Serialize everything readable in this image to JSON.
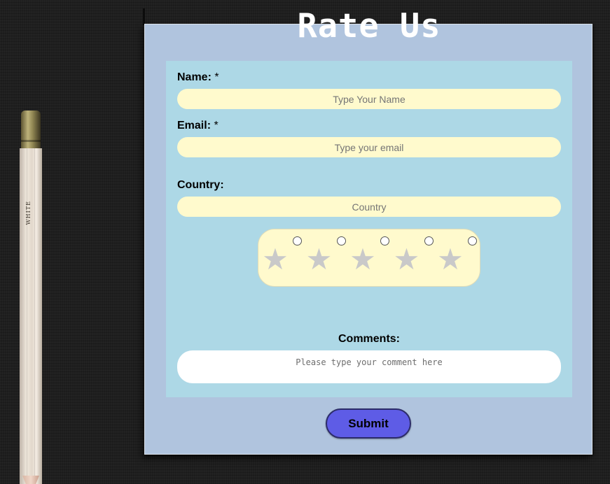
{
  "form": {
    "title": "Rate Us",
    "name_label": "Name:",
    "email_label": "Email:",
    "required_mark": "*",
    "name_placeholder": "Type Your Name",
    "email_placeholder": "Type your email",
    "country_label": "Country:",
    "country_placeholder": "Country",
    "rating": {
      "max_stars": 5,
      "selected": 0,
      "star_symbol": "★"
    },
    "comments_label": "Comments:",
    "comments_placeholder": "Please type your comment here",
    "submit_label": "Submit"
  },
  "pencil": {
    "brand_text": "WHITE"
  },
  "colors": {
    "background": "#1f1f1f",
    "card": "#b0c4de",
    "panel": "#add8e6",
    "field": "#fffacd",
    "submit": "#5e5ce6",
    "star_inactive": "#c9c9c9"
  }
}
